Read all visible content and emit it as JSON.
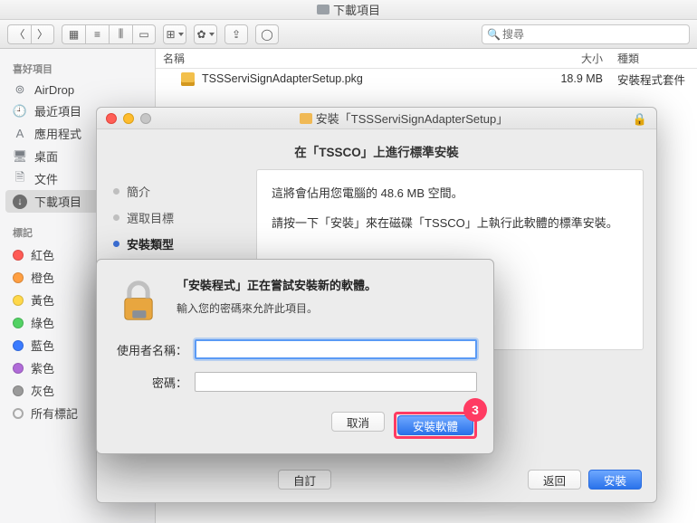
{
  "finder": {
    "title": "下載項目",
    "search_placeholder": "搜尋",
    "columns": {
      "name": "名稱",
      "size": "大小",
      "kind": "種類"
    },
    "file": {
      "name": "TSSServiSignAdapterSetup.pkg",
      "size": "18.9 MB",
      "kind": "安裝程式套件"
    }
  },
  "sidebar": {
    "fav_head": "喜好項目",
    "items": [
      "AirDrop",
      "最近項目",
      "應用程式",
      "桌面",
      "文件",
      "下載項目"
    ],
    "tag_head": "標記",
    "tags": [
      {
        "label": "紅色",
        "color": "#ff5b55"
      },
      {
        "label": "橙色",
        "color": "#ff9f42"
      },
      {
        "label": "黃色",
        "color": "#ffd84a"
      },
      {
        "label": "綠色",
        "color": "#53d264"
      },
      {
        "label": "藍色",
        "color": "#3b7bff"
      },
      {
        "label": "紫色",
        "color": "#b06bd8"
      },
      {
        "label": "灰色",
        "color": "#9a9a9a"
      }
    ],
    "all_tags": "所有標記"
  },
  "installer": {
    "title": "安裝「TSSServiSignAdapterSetup」",
    "subtitle": "在「TSSCO」上進行標準安裝",
    "steps": [
      "簡介",
      "選取目標",
      "安裝類型"
    ],
    "active_step": 2,
    "body_line1": "這將會佔用您電腦的 48.6 MB 空間。",
    "body_line2": "請按一下「安裝」來在磁碟「TSSCO」上執行此軟體的標準安裝。",
    "customize": "自訂",
    "back": "返回",
    "install": "安裝"
  },
  "auth": {
    "headline": "「安裝程式」正在嘗試安裝新的軟體。",
    "prompt": "輸入您的密碼來允許此項目。",
    "username_label": "使用者名稱：",
    "password_label": "密碼：",
    "username_value": "",
    "password_value": "",
    "cancel": "取消",
    "confirm": "安裝軟體",
    "badge": "3"
  }
}
